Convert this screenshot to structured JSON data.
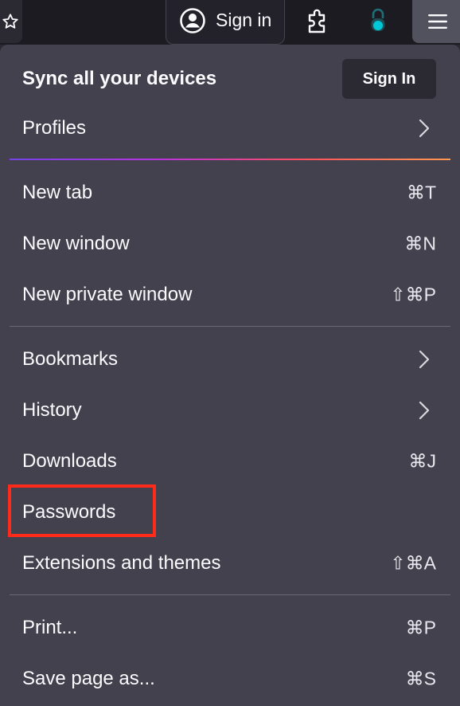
{
  "toolbar": {
    "signin_label": "Sign in"
  },
  "menu": {
    "sync_title": "Sync all your devices",
    "sync_button": "Sign In",
    "profiles": "Profiles",
    "items": {
      "new_tab": {
        "label": "New tab",
        "shortcut": "⌘T"
      },
      "new_window": {
        "label": "New window",
        "shortcut": "⌘N"
      },
      "new_private_window": {
        "label": "New private window",
        "shortcut": "⇧⌘P"
      },
      "bookmarks": {
        "label": "Bookmarks"
      },
      "history": {
        "label": "History"
      },
      "downloads": {
        "label": "Downloads",
        "shortcut": "⌘J"
      },
      "passwords": {
        "label": "Passwords"
      },
      "extensions": {
        "label": "Extensions and themes",
        "shortcut": "⇧⌘A"
      },
      "print": {
        "label": "Print...",
        "shortcut": "⌘P"
      },
      "save_page": {
        "label": "Save page as...",
        "shortcut": "⌘S"
      }
    }
  },
  "colors": {
    "panel_bg": "#42414d",
    "toolbar_bg": "#1c1b22",
    "highlight": "#ff2a1a",
    "lock_accent": "#00c8d7"
  }
}
